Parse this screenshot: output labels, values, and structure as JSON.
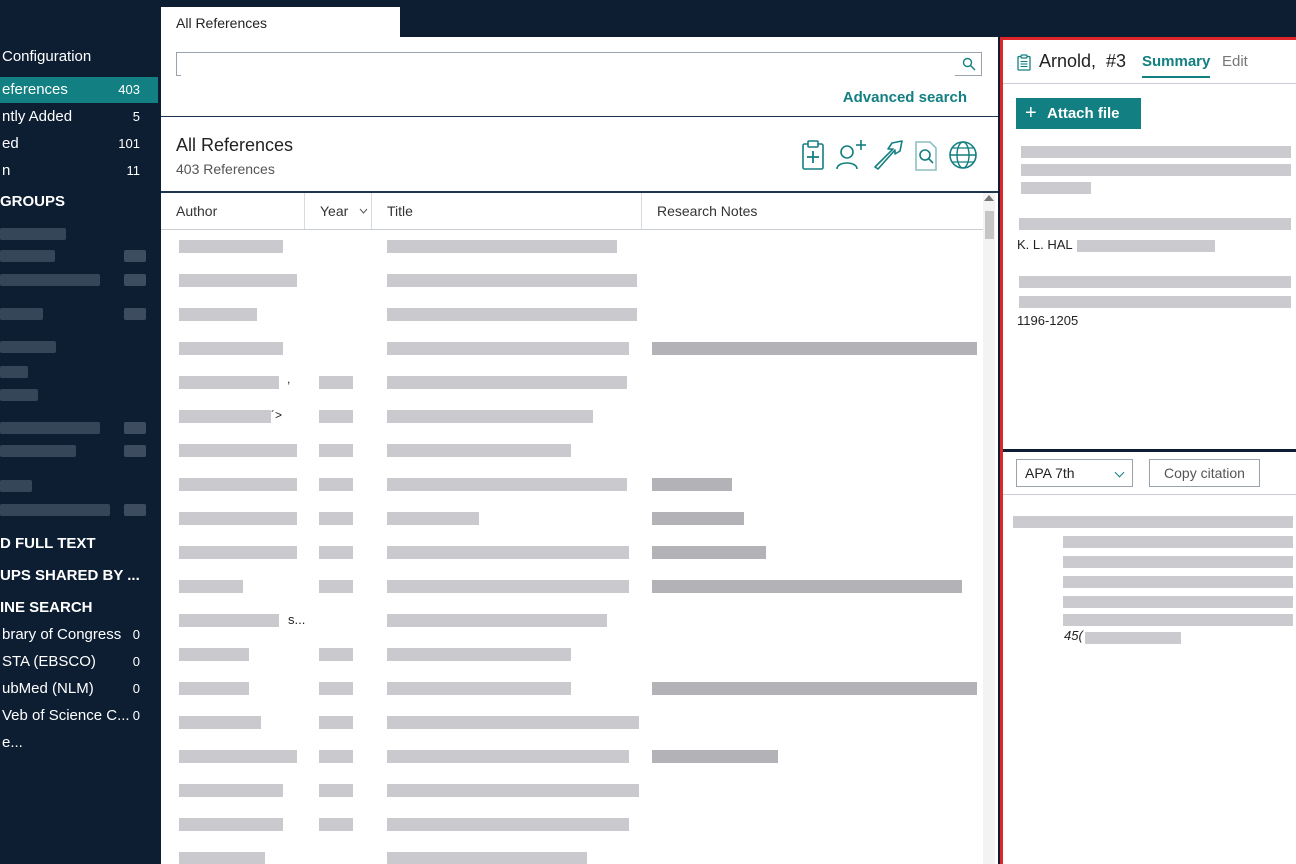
{
  "tabs": {
    "active_tab": "All References"
  },
  "sidebar": {
    "configuration_label": "Configuration",
    "items": [
      {
        "label": "eferences",
        "count": "403",
        "selected": true
      },
      {
        "label": "ntly Added",
        "count": "5"
      },
      {
        "label": "ed",
        "count": "101"
      },
      {
        "label": "n",
        "count": "11"
      }
    ],
    "groups_heading": "GROUPS",
    "full_text_heading": "D FULL TEXT",
    "shared_heading": "UPS SHARED BY ...",
    "online_search_heading": "INE SEARCH",
    "online_items": [
      {
        "label": "brary of Congress",
        "count": "0"
      },
      {
        "label": "STA (EBSCO)",
        "count": "0"
      },
      {
        "label": "ubMed (NLM)",
        "count": "0"
      },
      {
        "label": "Veb of Science C...",
        "count": "0"
      },
      {
        "label": "e...",
        "count": ""
      }
    ]
  },
  "search": {
    "value": "",
    "placeholder": "",
    "advanced_label": "Advanced search"
  },
  "list": {
    "title": "All References",
    "count_text": "403 References",
    "toolbar_icons": [
      "add-reference-icon",
      "add-person-icon",
      "share-arrow-icon",
      "find-document-icon",
      "online-globe-icon"
    ],
    "columns": [
      "Author",
      "Year",
      "Title",
      "Research Notes"
    ],
    "fragments": [
      {
        "row": 4,
        "text": ","
      },
      {
        "row": 5,
        "text": "´˃"
      },
      {
        "row": 11,
        "text": "s..."
      }
    ]
  },
  "detail": {
    "author": "Arnold,",
    "ref_number": "#3",
    "tab_summary": "Summary",
    "tab_edit": "Edit",
    "attach_label": "Attach file",
    "author_initials": "K. L. HAL",
    "pages": "1196-1205",
    "citation_style": "APA 7th",
    "copy_citation_label": "Copy citation",
    "citation_volume": "45("
  },
  "colors": {
    "accent": "#127f82",
    "sidebar_bg": "#0d1e33",
    "highlight_border": "#e0262a"
  }
}
